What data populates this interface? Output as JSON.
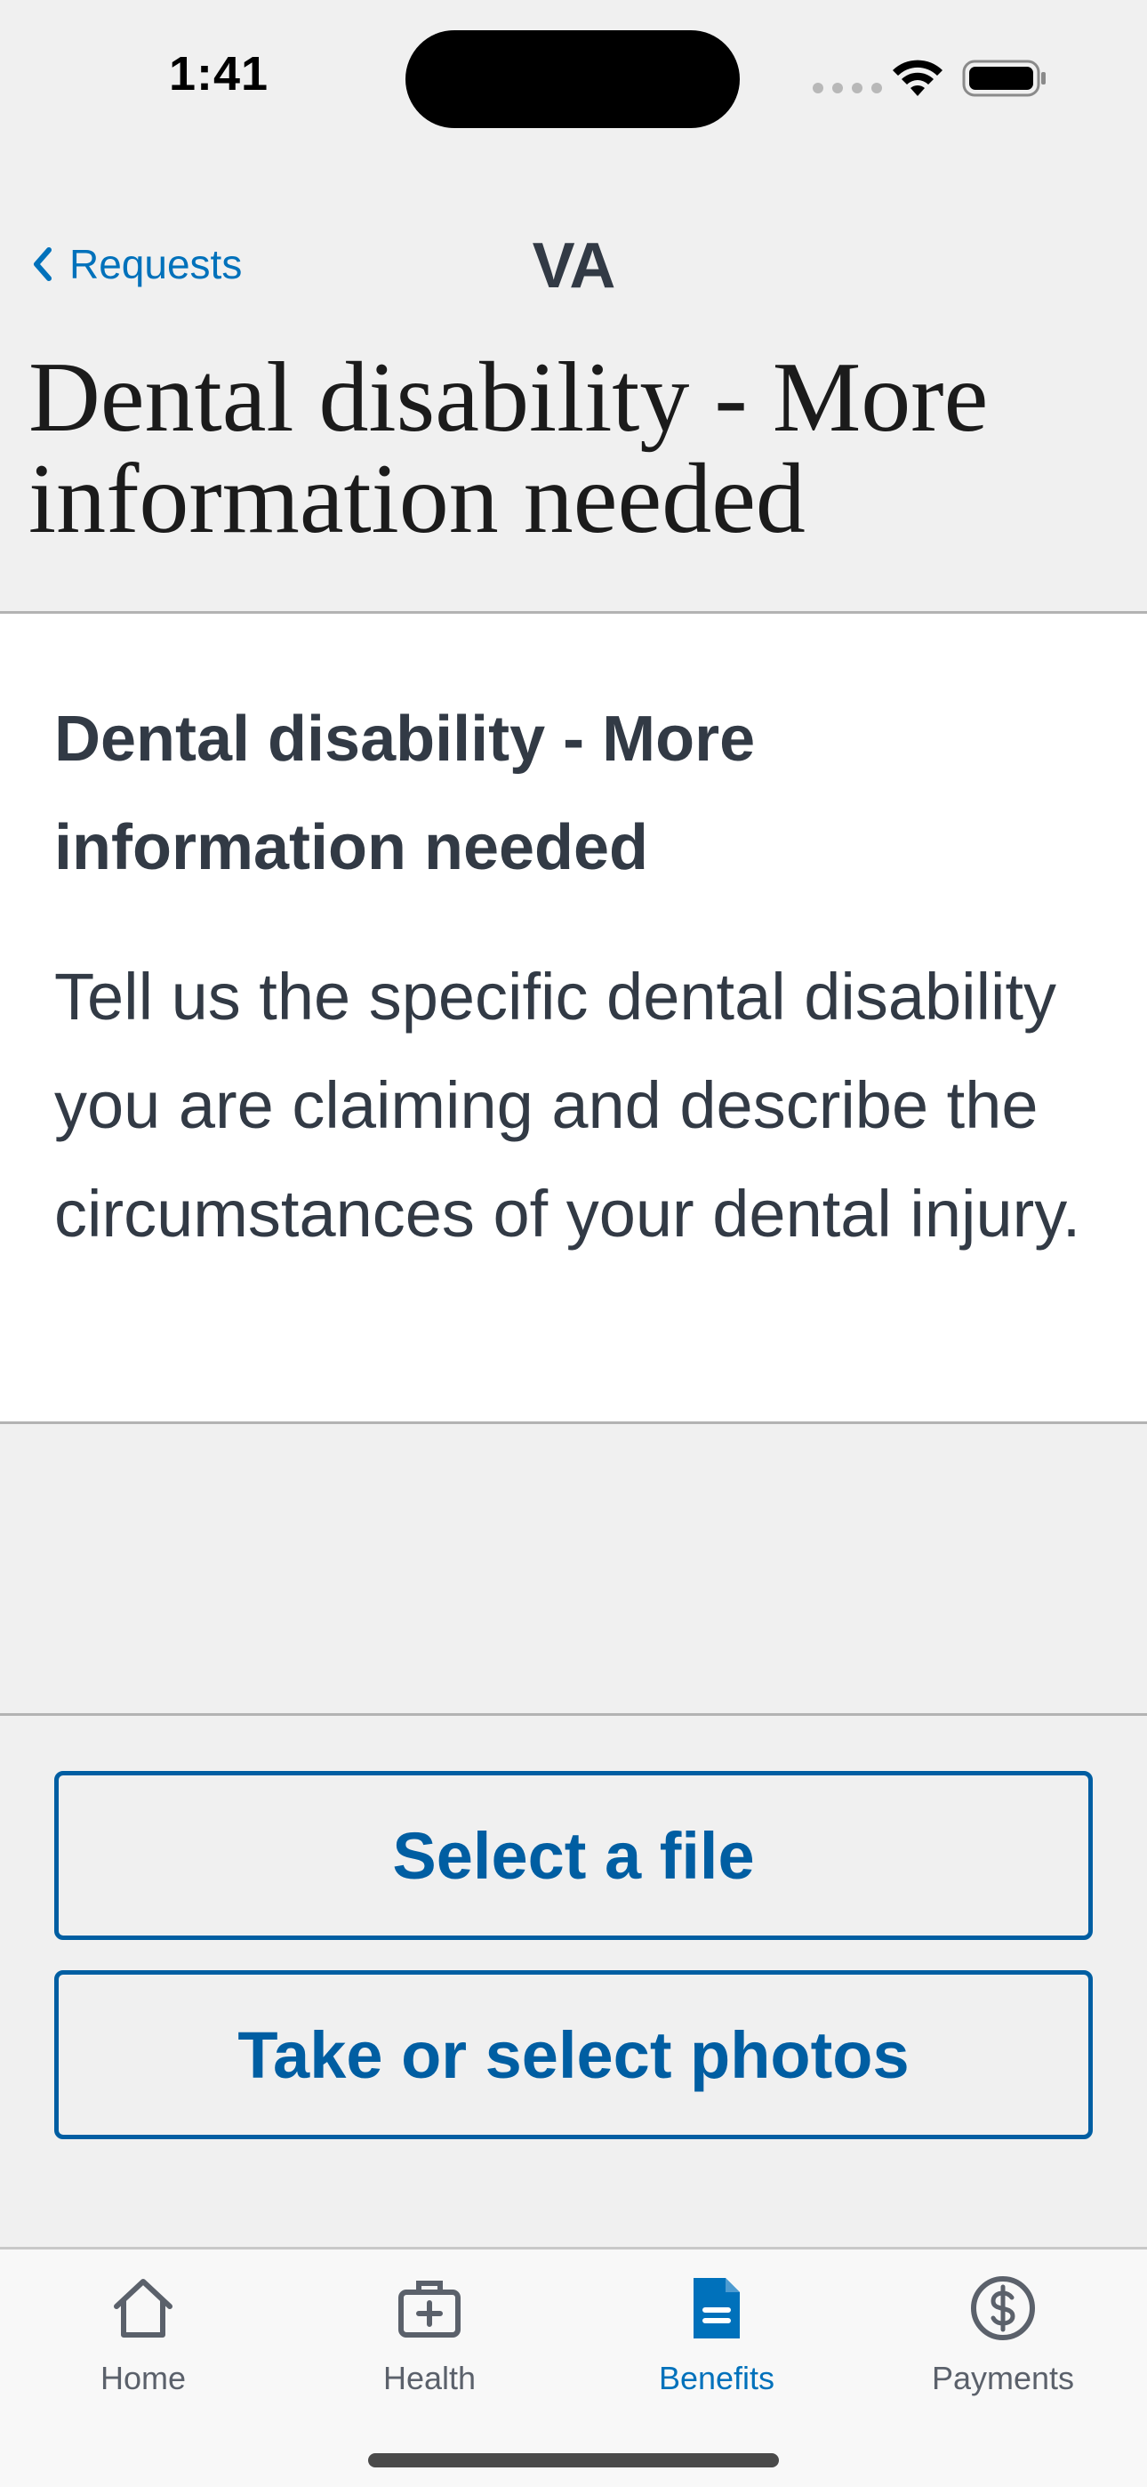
{
  "status_bar": {
    "time": "1:41"
  },
  "nav": {
    "back_label": "Requests",
    "logo_text": "VA"
  },
  "page": {
    "title": "Dental disability - More information needed"
  },
  "card": {
    "heading": "Dental disability - More information needed",
    "body": "Tell us the specific dental disability you are claiming and describe the circumstances of your dental injury."
  },
  "actions": {
    "select_file_label": "Select a file",
    "take_photos_label": "Take or select photos"
  },
  "tab_bar": {
    "items": [
      {
        "label": "Home",
        "icon": "home-icon",
        "active": false
      },
      {
        "label": "Health",
        "icon": "medical-kit-icon",
        "active": false
      },
      {
        "label": "Benefits",
        "icon": "document-icon",
        "active": true
      },
      {
        "label": "Payments",
        "icon": "dollar-circle-icon",
        "active": false
      }
    ]
  },
  "colors": {
    "accent": "#0071bb",
    "button_border": "#005ea2",
    "text": "#323a45",
    "background": "#f0f0f0",
    "card": "#ffffff"
  }
}
